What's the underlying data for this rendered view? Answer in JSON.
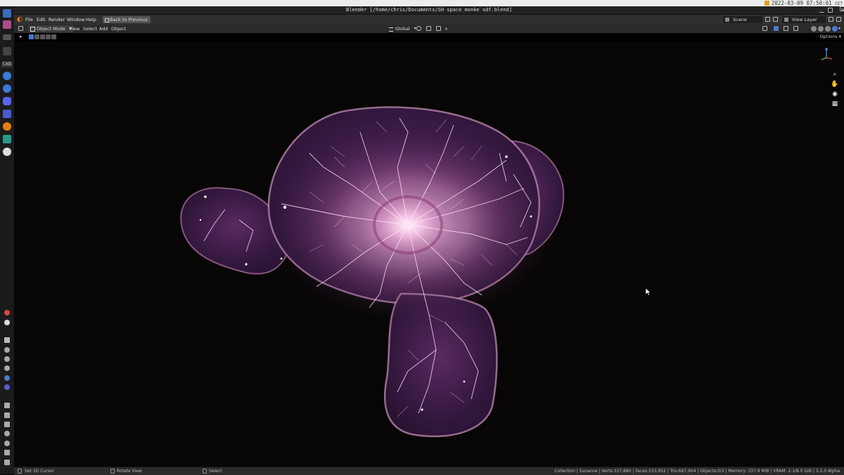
{
  "os": {
    "clock": "2022-03-09 07:50:01",
    "clock_suffix": "CET"
  },
  "dock": {
    "label": "CKB"
  },
  "window": {
    "title": "Blender [/home/chris/Documents/SH space monke sdf.blend]"
  },
  "menu": {
    "items": [
      "File",
      "Edit",
      "Render",
      "Window",
      "Help"
    ],
    "back_button": "Back to Previous",
    "scene": "Scene",
    "view_layer": "View Layer"
  },
  "viewport_header": {
    "mode": "Object Mode",
    "items": [
      "View",
      "Select",
      "Add",
      "Object"
    ],
    "orientation": "Global"
  },
  "tool_header": {
    "options": "Options"
  },
  "status": {
    "left": [
      {
        "label": "Set 3D Cursor"
      },
      {
        "label": "Rotate View"
      },
      {
        "label": "Select"
      }
    ],
    "stats": "Collection | Suzanne | Verts:337,880 | Faces:333,952 | Tris:667,904 | Objects:0/3 | Memory: 337.9 MiB | VRAM: 2.1/8.0 GiB | 3.2.0 Alpha"
  },
  "colors": {
    "accent": "#4a7ad0",
    "glow": "#ffd6f0",
    "skin": "#3a1d4a"
  }
}
